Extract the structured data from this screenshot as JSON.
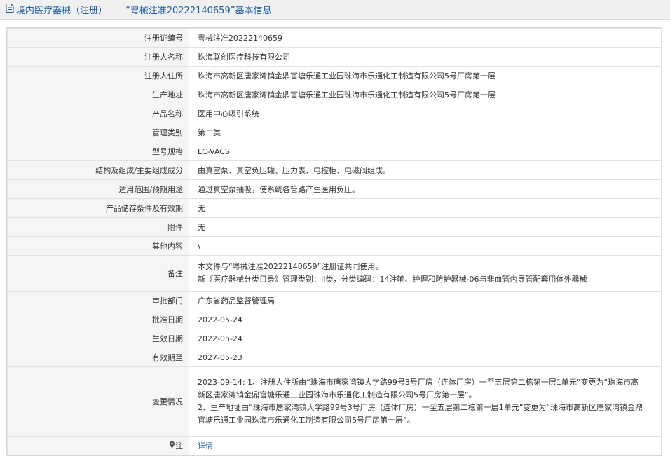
{
  "header": {
    "title": "境内医疗器械（注册）——“粤械注准20222140659”基本信息"
  },
  "rows": [
    {
      "label": "注册证编号",
      "value": "粤械注准20222140659"
    },
    {
      "label": "注册人名称",
      "value": "珠海联创医疗科技有限公司"
    },
    {
      "label": "注册人住所",
      "value": "珠海市高新区唐家湾镇金鼎官塘乐通工业园珠海市乐通化工制造有限公司5号厂房第一层"
    },
    {
      "label": "生产地址",
      "value": "珠海市高新区唐家湾镇金鼎官塘乐通工业园珠海市乐通化工制造有限公司5号厂房第一层"
    },
    {
      "label": "产品名称",
      "value": "医用中心吸引系统"
    },
    {
      "label": "管理类别",
      "value": "第二类"
    },
    {
      "label": "型号规格",
      "value": "LC-VACS"
    },
    {
      "label": "结构及组成/主要组成成分",
      "value": "由真空泵、真空负压罐、压力表、电控柜、电磁阀组成。"
    },
    {
      "label": "适用范围/预期用途",
      "value": "通过真空泵抽吸，使系统各管路产生医用负压。"
    },
    {
      "label": "产品储存条件及有效期",
      "value": "无"
    },
    {
      "label": "附件",
      "value": "无"
    },
    {
      "label": "其他内容",
      "value": "\\"
    },
    {
      "label": "备注",
      "lines": [
        "本文件与“粤械注准20222140659”注册证共同使用。",
        "新《医疗器械分类目录》管理类别：II类，分类编码：14注输、护理和防护器械-06与非血管内导管配套用体外器械"
      ]
    },
    {
      "label": "审批部门",
      "value": "广东省药品监督管理局"
    },
    {
      "label": "批准日期",
      "value": "2022-05-24"
    },
    {
      "label": "生效日期",
      "value": "2022-05-24"
    },
    {
      "label": "有效期至",
      "value": "2027-05-23"
    },
    {
      "label": "变更情况",
      "lines": [
        "2023-09-14: 1、注册人住所由“珠海市唐家湾镇大学路99号3号厂房（连体厂房）一至五层第二栋第一层1单元”变更为“珠海市高",
        "新区唐家湾镇金鼎官塘乐通工业园珠海市乐通化工制造有限公司5号厂房第一层”。",
        "2、生产地址由“珠海市唐家湾镇大学路99号3号厂房（连体厂房）一至五层第二栋第一层1单元”变更为“珠海市高新区唐家湾镇金鼎",
        "官塘乐通工业园珠海市乐通化工制造有限公司5号厂房第一层”。"
      ]
    },
    {
      "label": "注",
      "value": "详情"
    }
  ],
  "icons": {
    "title": "document-icon",
    "note": "pin-icon"
  }
}
